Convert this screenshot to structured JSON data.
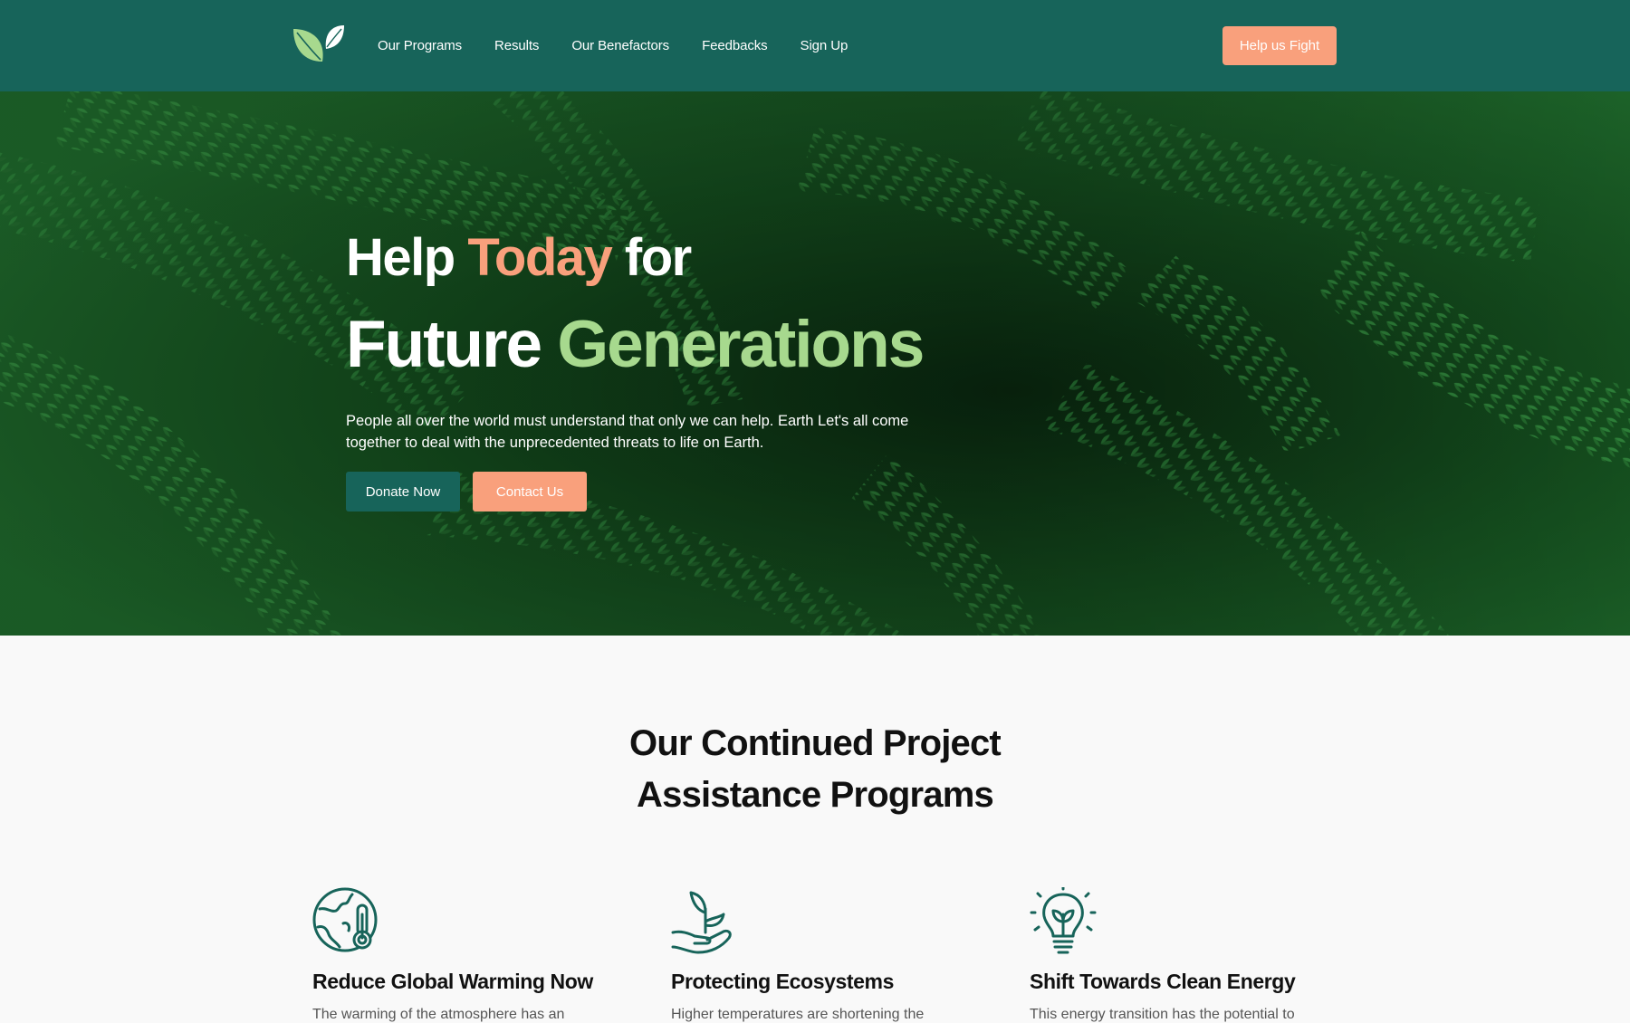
{
  "nav": {
    "links": [
      "Our Programs",
      "Results",
      "Our Benefactors",
      "Feedbacks",
      "Sign Up"
    ],
    "cta_label": "Help us Fight"
  },
  "hero": {
    "line1_a": "Help ",
    "line1_b": "Today",
    "line1_c": " for",
    "line2_a": "Future ",
    "line2_b": "Generations",
    "description": "People all over the world must understand that only we can help. Earth Let's all come together to deal with the unprecedented threats to life on Earth.",
    "donate_label": "Donate Now",
    "contact_label": "Contact Us"
  },
  "programs": {
    "title_line1": "Our Continued Project",
    "title_line2": "Assistance Programs",
    "items": [
      {
        "icon": "globe-thermometer-icon",
        "title": "Reduce Global Warming Now",
        "text": "The warming of the atmosphere has an"
      },
      {
        "icon": "hand-plant-icon",
        "title": "Protecting Ecosystems",
        "text": "Higher temperatures are shortening the"
      },
      {
        "icon": "lightbulb-leaf-icon",
        "title": "Shift Towards Clean Energy",
        "text": "This energy transition has the potential to"
      }
    ]
  },
  "colors": {
    "primary": "#17645a",
    "accent_orange": "#f9a07c",
    "accent_green": "#a7d98e"
  }
}
